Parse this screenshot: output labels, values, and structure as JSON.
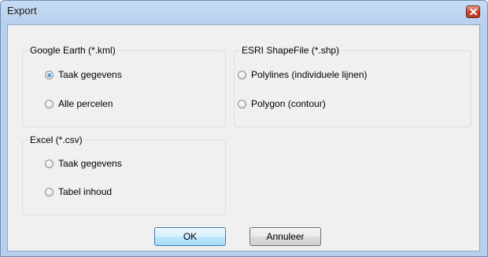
{
  "window": {
    "title": "Export"
  },
  "groups": {
    "kml": {
      "title": "Google Earth (*.kml)",
      "options": [
        {
          "label": "Taak gegevens",
          "checked": true
        },
        {
          "label": "Alle percelen",
          "checked": false
        }
      ]
    },
    "shp": {
      "title": "ESRI ShapeFile (*.shp)",
      "options": [
        {
          "label": "Polylines (individuele lijnen)",
          "checked": false
        },
        {
          "label": "Polygon (contour)",
          "checked": false
        }
      ]
    },
    "csv": {
      "title": "Excel (*.csv)",
      "options": [
        {
          "label": "Taak gegevens",
          "checked": false
        },
        {
          "label": "Tabel inhoud",
          "checked": false
        }
      ]
    }
  },
  "buttons": {
    "ok": "OK",
    "cancel": "Annuleer"
  },
  "colors": {
    "title_bar": "#b7d0ec",
    "close_button": "#c8452e",
    "dialog_background": "#f0f0f0"
  }
}
